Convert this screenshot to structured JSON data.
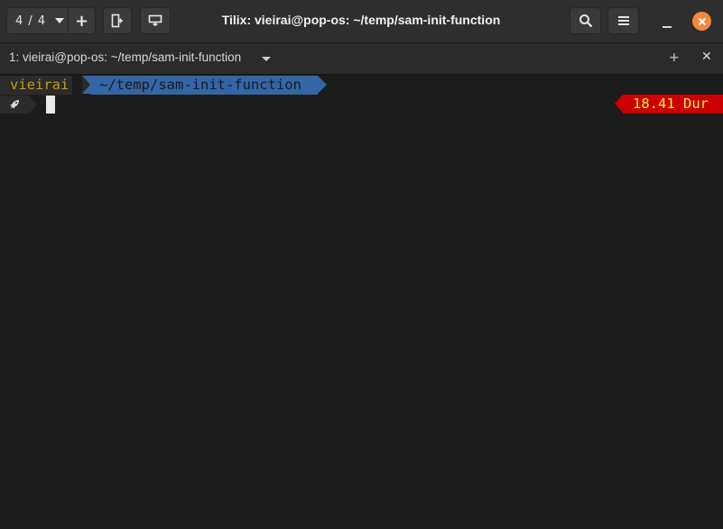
{
  "header": {
    "session_count": "4 / 4",
    "add_label": "+",
    "title": "Tilix: vieirai@pop-os: ~/temp/sam-init-function",
    "icons": {
      "session_caret": "chevron-down-icon",
      "add_terminal_right": "split-right-icon",
      "add_terminal_down": "split-down-icon",
      "search": "search-icon",
      "menu": "hamburger-menu-icon",
      "minimize": "minimize-icon",
      "close": "close-icon"
    },
    "colors": {
      "close_button": "#f5883c"
    }
  },
  "terminal_bar": {
    "title": "1: vieirai@pop-os: ~/temp/sam-init-function",
    "add_label": "+",
    "close_label": "✕"
  },
  "terminal": {
    "prompt_user": "vieirai",
    "prompt_path": "~/temp/sam-init-function",
    "prompt_icon": "rocket-icon",
    "right_prompt": "18.41 Dur",
    "colors": {
      "user_fg": "#c4a000",
      "path_bg": "#3465a4",
      "right_prompt_bg": "#cc0000",
      "right_prompt_fg": "#fce94f"
    }
  }
}
